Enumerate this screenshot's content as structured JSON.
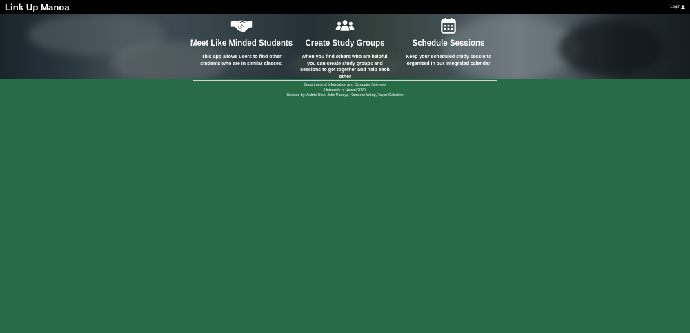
{
  "navbar": {
    "brand": "Link Up Manoa",
    "login_label": "Login"
  },
  "features": [
    {
      "icon": "handshake-icon",
      "title": "Meet Like Minded Students",
      "description": "This app allows users to find other students who are in similar classes."
    },
    {
      "icon": "users-icon",
      "title": "Create Study Groups",
      "description": "When you find others who are helpful, you can create study groups and sessions to get together and help each other"
    },
    {
      "icon": "calendar-icon",
      "title": "Schedule Sessions",
      "description": "Keep your scheduled study sessions organized in our integrated calendar"
    }
  ],
  "footer": {
    "line1": "Department of Information and Computer Sciences",
    "line2": "University of Hawaii 2020",
    "line3": "Created by: Aubrie Usui, Jatin Pandya, Kameron Wong, Taylor Gabatino"
  },
  "colors": {
    "navbar_bg": "#000000",
    "page_bg": "#276c47",
    "text": "#ffffff"
  }
}
